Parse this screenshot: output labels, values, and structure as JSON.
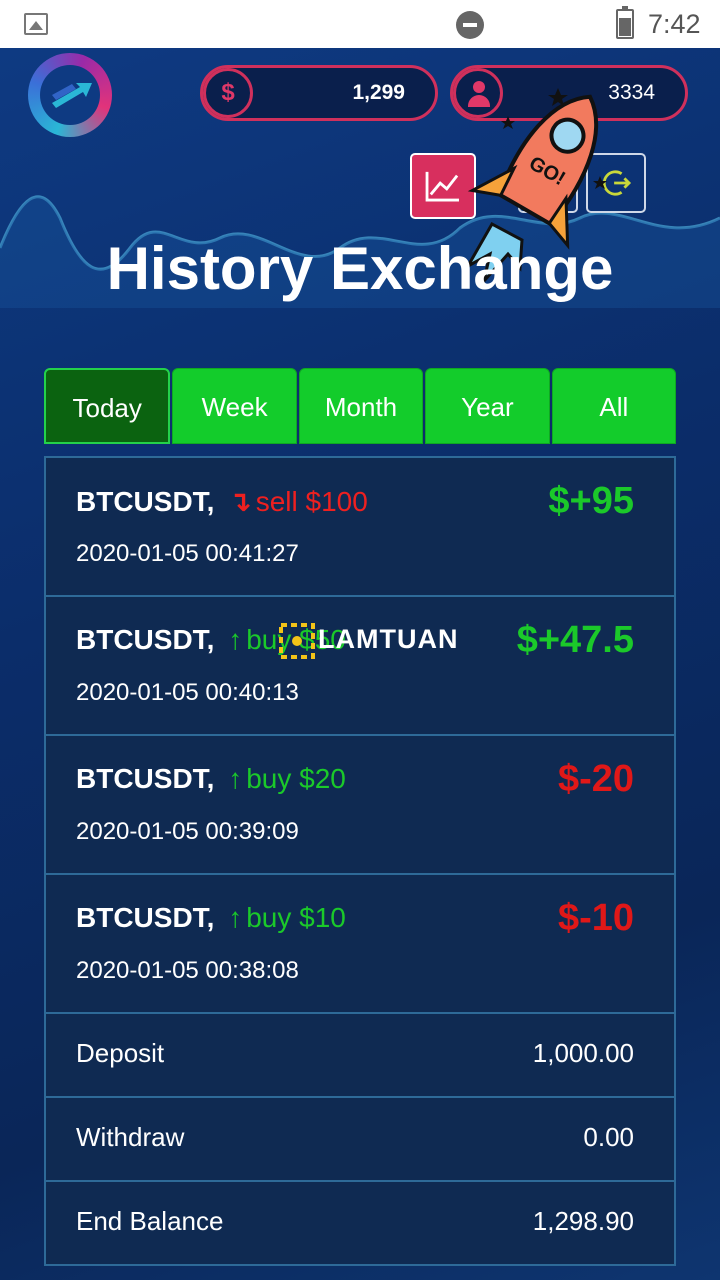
{
  "status_bar": {
    "time": "7:42"
  },
  "header": {
    "coin_symbol": "$",
    "coin_value": "1,299",
    "user_id": "3334"
  },
  "page": {
    "title": "History Exchange"
  },
  "tabs": [
    {
      "label": "Today",
      "active": true
    },
    {
      "label": "Week",
      "active": false
    },
    {
      "label": "Month",
      "active": false
    },
    {
      "label": "Year",
      "active": false
    },
    {
      "label": "All",
      "active": false
    }
  ],
  "trades": [
    {
      "pair": "BTCUSDT,",
      "direction": "sell",
      "amount": "sell $100",
      "time": "2020-01-05 00:41:27",
      "profit": "$+95",
      "profit_color": "#1bc92a",
      "direction_color": "#ee2020"
    },
    {
      "pair": "BTCUSDT,",
      "direction": "buy",
      "amount": "buy $50",
      "time": "2020-01-05 00:40:13",
      "profit": "$+47.5",
      "profit_color": "#1bc92a",
      "direction_color": "#1bc92a"
    },
    {
      "pair": "BTCUSDT,",
      "direction": "buy",
      "amount": "buy $20",
      "time": "2020-01-05 00:39:09",
      "profit": "$-20",
      "profit_color": "#e01818",
      "direction_color": "#1bc92a"
    },
    {
      "pair": "BTCUSDT,",
      "direction": "buy",
      "amount": "buy $10",
      "time": "2020-01-05 00:38:08",
      "profit": "$-10",
      "profit_color": "#e01818",
      "direction_color": "#1bc92a"
    }
  ],
  "summary": [
    {
      "label": "Deposit",
      "value": "1,000.00"
    },
    {
      "label": "Withdraw",
      "value": "0.00"
    },
    {
      "label": "End Balance",
      "value": "1,298.90"
    }
  ],
  "sticker": {
    "text": "GO!"
  },
  "watermark": {
    "text": "LAMTUAN"
  },
  "colors": {
    "accent": "#d0305c",
    "tab_green": "#13cc2b",
    "tab_active": "#0b6310",
    "card_bg": "#0f2a52"
  }
}
